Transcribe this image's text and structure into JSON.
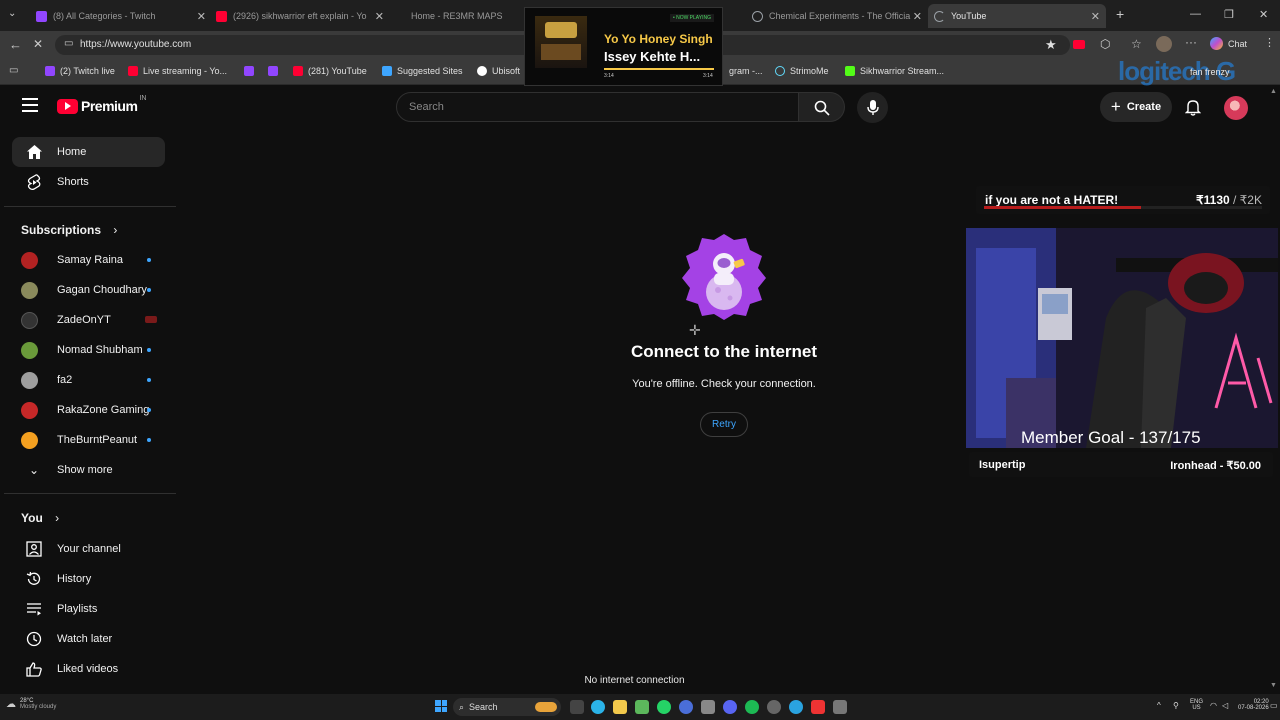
{
  "browser": {
    "tabs": [
      {
        "label": "(8) All Categories - Twitch",
        "color": "#9146ff"
      },
      {
        "label": "(2926) sikhwarrior eft explain - Yo",
        "color": "#ff0033"
      },
      {
        "label": "Home - RE3MR MAPS",
        "color": "#555555"
      },
      {
        "label": "Chemical Experiments - The Officia",
        "color": "#9aa0a6"
      },
      {
        "label": "YouTube",
        "color": "#9aa0a6"
      }
    ],
    "url": "https://www.youtube.com",
    "chat_label": "Chat",
    "bookmarks": [
      {
        "label": "(2) Twitch live",
        "color": "#9146ff"
      },
      {
        "label": "Live streaming - Yo...",
        "color": "#ff0033"
      },
      {
        "label": "(281) YouTube",
        "color": "#ff0033"
      },
      {
        "label": "Suggested Sites",
        "color": "#3ea6ff"
      },
      {
        "label": "Ubisoft",
        "color": "#ffffff"
      },
      {
        "label": "gram -...",
        "color": "#999999"
      },
      {
        "label": "StrimoMe",
        "color": "#61dafb"
      },
      {
        "label": "Sikhwarrior Stream...",
        "color": "#53fc18"
      }
    ]
  },
  "now_playing": {
    "badge": "• NOW PLAYING",
    "artist": "Yo Yo Honey Singh",
    "title": "Issey Kehte H...",
    "elapsed": "3:14",
    "duration": "3:14",
    "progress": 1.0
  },
  "watermark": "logitech G",
  "watermark_right": "fan frenzy",
  "youtube": {
    "logo": "Premium",
    "region": "IN",
    "search_placeholder": "Search",
    "create_label": "Create",
    "sidebar": {
      "main": [
        {
          "label": "Home",
          "icon": "home-icon"
        },
        {
          "label": "Shorts",
          "icon": "shorts-icon"
        }
      ],
      "subscriptions_title": "Subscriptions",
      "subscriptions": [
        {
          "label": "Samay Raina",
          "color": "#b22222"
        },
        {
          "label": "Gagan Choudhary",
          "color": "#8a8a5c"
        },
        {
          "label": "ZadeOnYT",
          "color": "#333333"
        },
        {
          "label": "Nomad Shubham",
          "color": "#6a9a3a"
        },
        {
          "label": "fa2",
          "color": "#9e9e9e"
        },
        {
          "label": "RakaZone Gaming",
          "color": "#c62828"
        },
        {
          "label": "TheBurntPeanut",
          "color": "#f4a020"
        }
      ],
      "show_more": "Show more",
      "you_title": "You",
      "you_items": [
        {
          "label": "Your channel",
          "icon": "channel-icon"
        },
        {
          "label": "History",
          "icon": "history-icon"
        },
        {
          "label": "Playlists",
          "icon": "playlists-icon"
        },
        {
          "label": "Watch later",
          "icon": "clock-icon"
        },
        {
          "label": "Liked videos",
          "icon": "thumbs-up-icon"
        }
      ]
    },
    "offline": {
      "title": "Connect to the internet",
      "subtitle": "You're offline. Check your connection.",
      "retry": "Retry"
    },
    "toast": "No internet connection"
  },
  "stream_overlay": {
    "hater_text": "if you are not a HATER!",
    "hater_amount": "₹1130",
    "hater_goal": " / ₹2K",
    "hater_progress": 0.565,
    "member_goal": "Member Goal - 137/175",
    "supertip_label": "Isupertip",
    "supertip_value": "Ironhead - ₹50.00"
  },
  "taskbar": {
    "weather_temp": "28°C",
    "weather_desc": "Mostly cloudy",
    "search": "Search",
    "lang": "ENG",
    "region": "US",
    "time": "02:20",
    "date": "07-08-2026"
  }
}
